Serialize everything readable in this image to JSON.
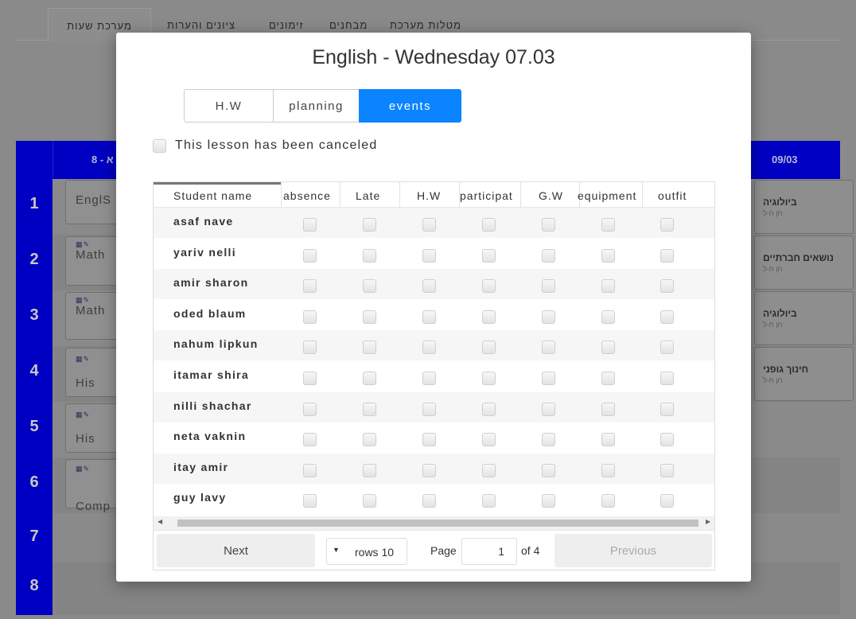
{
  "background": {
    "tabs": [
      "מערכת שעות",
      "ציונים והערות",
      "זימונים",
      "מבחנים",
      "מטלות מערכת"
    ],
    "grid_header": {
      "day_left": "א - 8",
      "day_right": "09/03"
    },
    "period_numbers": [
      "1",
      "2",
      "3",
      "4",
      "5",
      "6",
      "7",
      "8"
    ],
    "lesson_cards": [
      {
        "label": "EnglS"
      },
      {
        "label": "Math"
      },
      {
        "label": "Math"
      },
      {
        "label": "His"
      },
      {
        "label": "His"
      },
      {
        "label": "Comp"
      }
    ],
    "right_cards": [
      {
        "title": "ביולוגיה",
        "sub": "חן ח-ל"
      },
      {
        "title": "נושאים חברתיים",
        "sub": "חן ח-ל"
      },
      {
        "title": "ביולוגיה",
        "sub": "חן ח-ל"
      },
      {
        "title": "חינוך גופני",
        "sub": "חן ח-ל"
      }
    ]
  },
  "modal": {
    "title": "English - Wednesday   07.03",
    "tabs": [
      {
        "label": "H.W",
        "active": false
      },
      {
        "label": "planning",
        "active": false
      },
      {
        "label": "events",
        "active": true
      }
    ],
    "canceled_label": "This lesson has been canceled",
    "columns": [
      "Student name",
      "absence",
      "Late",
      "H.W",
      "participat",
      "G.W",
      "equipment",
      "outfit"
    ],
    "students": [
      "asaf nave",
      "yariv nelli",
      "amir sharon",
      "oded blaum",
      "nahum lipkun",
      "itamar shira",
      "nilli shachar",
      "neta vaknin",
      "itay amir",
      "guy lavy"
    ],
    "pager": {
      "next": "Next",
      "rows": "rows 10",
      "page_label": "Page",
      "page_value": "1",
      "of": "of 4",
      "previous": "Previous"
    }
  },
  "colors": {
    "accent": "#0a84ff",
    "grid_header_bg": "#0000c2"
  }
}
